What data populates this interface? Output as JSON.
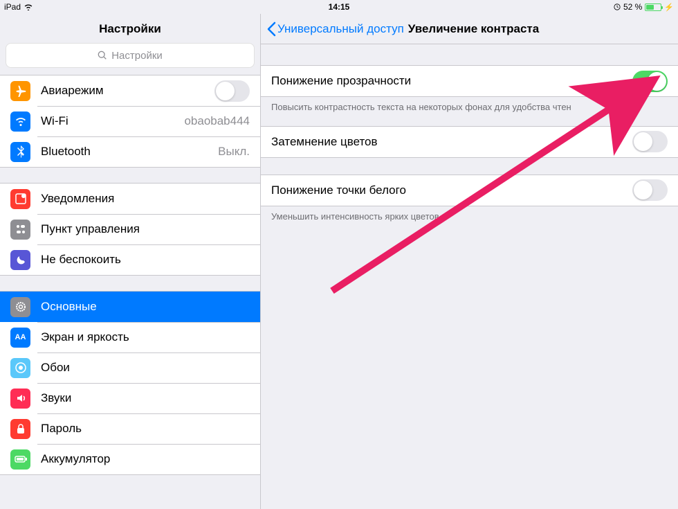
{
  "status": {
    "device": "iPad",
    "time": "14:15",
    "battery_text": "52 %"
  },
  "sidebar": {
    "title": "Настройки",
    "search_placeholder": "Настройки",
    "group1": {
      "airplane": "Авиарежим",
      "wifi": "Wi-Fi",
      "wifi_value": "obaobab444",
      "bluetooth": "Bluetooth",
      "bluetooth_value": "Выкл."
    },
    "group2": {
      "notifications": "Уведомления",
      "control_center": "Пункт управления",
      "dnd": "Не беспокоить"
    },
    "group3": {
      "general": "Основные",
      "display": "Экран и яркость",
      "wallpaper": "Обои",
      "sounds": "Звуки",
      "passcode": "Пароль",
      "battery": "Аккумулятор"
    }
  },
  "detail": {
    "back_label": "Универсальный доступ",
    "title": "Увеличение контраста",
    "reduce_transparency": "Понижение прозрачности",
    "reduce_transparency_footer": "Повысить контрастность текста на некоторых фонах для удобства чтен",
    "darken_colors": "Затемнение цветов",
    "reduce_white_point": "Понижение точки белого",
    "reduce_white_point_footer": "Уменьшить интенсивность ярких цветов."
  }
}
